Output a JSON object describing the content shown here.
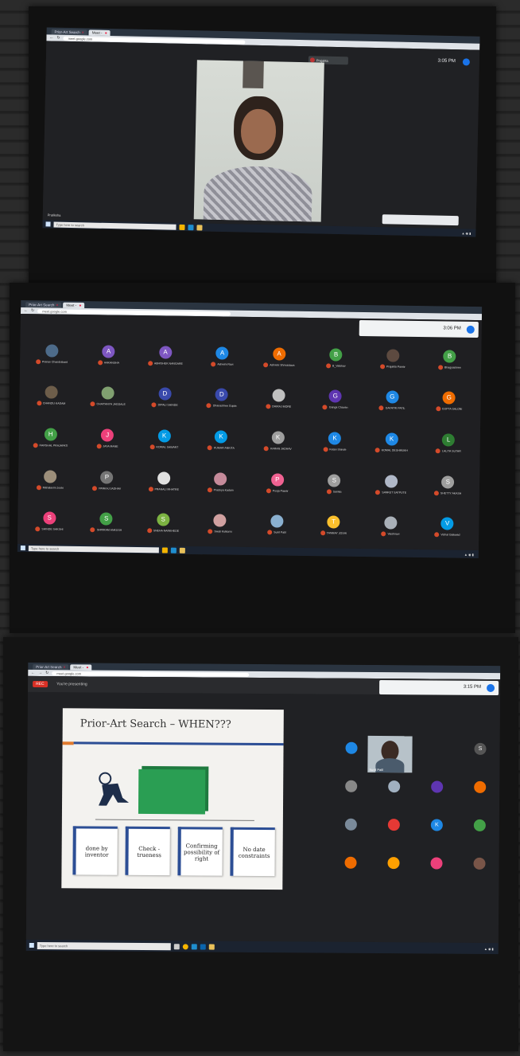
{
  "photo1": {
    "tab1": "Prior-Art Search",
    "tab2": "Meet - ",
    "url": "meet.google.com",
    "presenter_chip": "Prajakta",
    "time": "3:05 PM",
    "self_label": "Pratiksha",
    "taskbar_search": "Type here to search"
  },
  "photo2": {
    "tab1": "Prior-Art Search",
    "tab2": "Meet - ",
    "url": "meet.google.com",
    "time": "3:06 PM",
    "taskbar_search": "Type here to search",
    "participants": [
      {
        "initial": "",
        "color": "#4d6b8a",
        "name": "Pranav Chandrakant"
      },
      {
        "initial": "A",
        "color": "#7e57c2",
        "name": "AAKANSHA"
      },
      {
        "initial": "A",
        "color": "#7e57c2",
        "name": "ABHISHEK NANGARE"
      },
      {
        "initial": "A",
        "color": "#1e88e5",
        "name": "Ashwini Ravi"
      },
      {
        "initial": "A",
        "color": "#ef6c00",
        "name": "Ashwini Shrivastava"
      },
      {
        "initial": "B",
        "color": "#43a047",
        "name": "B_Vaibhav"
      },
      {
        "initial": "",
        "color": "#5d4a40",
        "name": "Prajakta Pawar"
      },
      {
        "initial": "B",
        "color": "#43a047",
        "name": "Bhagyashree"
      },
      {
        "initial": "",
        "color": "#6d5d4a",
        "name": "CHANDU KADAM"
      },
      {
        "initial": "",
        "color": "#80a070",
        "name": "CHAITANYA JAGDALE"
      },
      {
        "initial": "D",
        "color": "#3949ab",
        "name": "DIPALI SHINDE"
      },
      {
        "initial": "D",
        "color": "#3949ab",
        "name": "Dhanashree Gupta"
      },
      {
        "initial": "",
        "color": "#c0c0c0",
        "name": "DHIRAJ MORE"
      },
      {
        "initial": "G",
        "color": "#5e35b1",
        "name": "Ganga Chavan"
      },
      {
        "initial": "G",
        "color": "#1e88e5",
        "name": "GAYATRI PATIL"
      },
      {
        "initial": "G",
        "color": "#ef6c00",
        "name": "GUPTA SALONI"
      },
      {
        "initial": "H",
        "color": "#43a047",
        "name": "HARSHAL PRAJAPATI"
      },
      {
        "initial": "J",
        "color": "#ec407a",
        "name": "JAYA MANE"
      },
      {
        "initial": "K",
        "color": "#039be5",
        "name": "KOMAL SAWANT"
      },
      {
        "initial": "K",
        "color": "#039be5",
        "name": "KUMAR ANKITA"
      },
      {
        "initial": "K",
        "color": "#9e9e9e",
        "name": "KARAN JADHAV"
      },
      {
        "initial": "K",
        "color": "#1e88e5",
        "name": "Ketan Shinde"
      },
      {
        "initial": "K",
        "color": "#1e88e5",
        "name": "KOMAL DESHMUKH"
      },
      {
        "initial": "L",
        "color": "#2e7d32",
        "name": "LALITA SUTAR"
      },
      {
        "initial": "",
        "color": "#9c8e7a",
        "name": "Mahalaxmi Joshi"
      },
      {
        "initial": "P",
        "color": "#757575",
        "name": "PANKAJ JADHAV"
      },
      {
        "initial": "",
        "color": "#e0e0e0",
        "name": "PRANALI MHATRE"
      },
      {
        "initial": "",
        "color": "#c58a9a",
        "name": "Pradnya Kadam"
      },
      {
        "initial": "P",
        "color": "#f06292",
        "name": "Pooja Pawar"
      },
      {
        "initial": "S",
        "color": "#9e9e9e",
        "name": "Sanika"
      },
      {
        "initial": "",
        "color": "#b0b8c8",
        "name": "SANKET SATPUTE"
      },
      {
        "initial": "S",
        "color": "#9e9e9e",
        "name": "SHETTY AKASH"
      },
      {
        "initial": "S",
        "color": "#ec407a",
        "name": "SHINDE SAKSHI"
      },
      {
        "initial": "S",
        "color": "#43a047",
        "name": "SHRIRAM ANKUSH"
      },
      {
        "initial": "S",
        "color": "#7cb342",
        "name": "SNEHA NARKHEDE"
      },
      {
        "initial": "",
        "color": "#d0a0a0",
        "name": "Swati Kulkarni"
      },
      {
        "initial": "",
        "color": "#8ab0d0",
        "name": "Sunil Patil"
      },
      {
        "initial": "T",
        "color": "#fbc02d",
        "name": "TANMAY JOSHI"
      },
      {
        "initial": "",
        "color": "#a9b0b8",
        "name": "Vaishnavi"
      },
      {
        "initial": "V",
        "color": "#039be5",
        "name": "Vishal Gaikwad"
      }
    ]
  },
  "photo3": {
    "tab1": "Prior-Art Search",
    "tab2": "Meet - ",
    "url": "meet.google.com",
    "time": "3:15 PM",
    "rec_label": "REC",
    "presenting": "You're presenting",
    "taskbar_search": "Type here to search",
    "presenter_name": "Sunil Patil",
    "slide": {
      "title": "Prior-Art Search – WHEN???",
      "boxes": [
        "done by inventor",
        "Check - trueness",
        "Confirming possibility of right",
        "No date constraints"
      ]
    },
    "grid": [
      {
        "initial": "",
        "color": "#1e88e5"
      },
      {
        "initial": "S",
        "color": "#555"
      },
      {
        "initial": "",
        "color": "#888"
      },
      {
        "initial": "",
        "color": "#a0b0c0"
      },
      {
        "initial": "",
        "color": "#5e35b1"
      },
      {
        "initial": "",
        "color": "#ef6c00"
      },
      {
        "initial": "",
        "color": "#7a8a9a"
      },
      {
        "initial": "",
        "color": "#e53935"
      },
      {
        "initial": "K",
        "color": "#1e88e5"
      },
      {
        "initial": "",
        "color": "#43a047"
      },
      {
        "initial": "",
        "color": "#ef6c00"
      },
      {
        "initial": "",
        "color": "#ffa000"
      },
      {
        "initial": "",
        "color": "#ec407a"
      },
      {
        "initial": "",
        "color": "#795548"
      }
    ]
  }
}
